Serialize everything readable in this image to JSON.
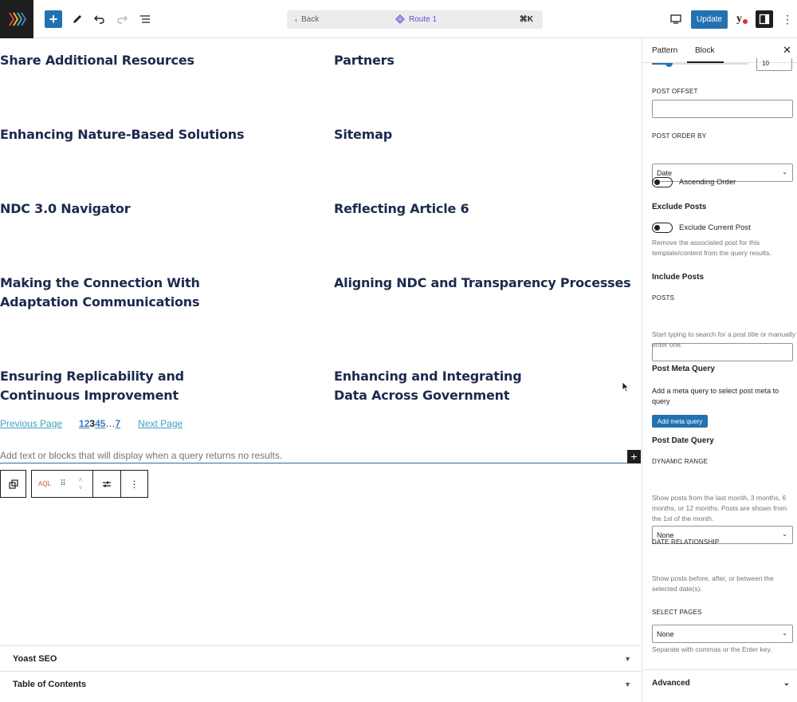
{
  "topbar": {
    "back_label": "Back",
    "route_label": "Route 1",
    "shortcut": "⌘K",
    "update_label": "Update",
    "yoast_glyph": "y"
  },
  "canvas": {
    "posts": [
      "Share Additional Resources",
      "Partners",
      "Enhancing Nature-Based Solutions",
      "Sitemap",
      "NDC 3.0 Navigator",
      "Reflecting Article 6",
      "Making the Connection With Adaptation Communications",
      "Aligning NDC and Transparency Processes",
      "Ensuring Replicability and Continuous Improvement",
      "Enhancing and Integrating Data Across Government"
    ],
    "pagination": {
      "previous": "Previous Page",
      "pages": [
        "1",
        "2",
        "3",
        "4",
        "5",
        "…",
        "7"
      ],
      "current": "3",
      "next": "Next Page"
    },
    "no_results_placeholder": "Add text or blocks that will display when a query returns no results.",
    "block_label": "AQL",
    "meta_boxes": [
      "Yoast SEO",
      "Table of Contents"
    ]
  },
  "sidebar": {
    "tabs": [
      "Pattern",
      "Block"
    ],
    "partial_value": "10",
    "post_offset_label": "POST OFFSET",
    "post_order_by_label": "POST ORDER BY",
    "post_order_by_value": "Date",
    "ascending_label": "Ascending Order",
    "exclude_heading": "Exclude Posts",
    "exclude_current_label": "Exclude Current Post",
    "exclude_help": "Remove the associated post for this template/content from the query results.",
    "include_heading": "Include Posts",
    "posts_label": "POSTS",
    "posts_help": "Start typing to search for a post title or manually enter one.",
    "meta_query_heading": "Post Meta Query",
    "meta_query_help": "Add a meta query to select post meta to query",
    "add_meta_button": "Add meta query",
    "date_query_heading": "Post Date Query",
    "dynamic_range_label": "DYNAMIC RANGE",
    "dynamic_range_value": "None",
    "dynamic_range_help": "Show posts from the last month, 3 months, 6 months, or 12 months. Posts are shown from the 1st of the month.",
    "date_relationship_label": "DATE RELATIONSHIP",
    "date_relationship_value": "None",
    "date_relationship_help": "Show posts before, after, or between the selected date(s).",
    "select_pages_label": "SELECT PAGES",
    "select_pages_help": "Separate with commas or the Enter key.",
    "advanced_label": "Advanced"
  }
}
